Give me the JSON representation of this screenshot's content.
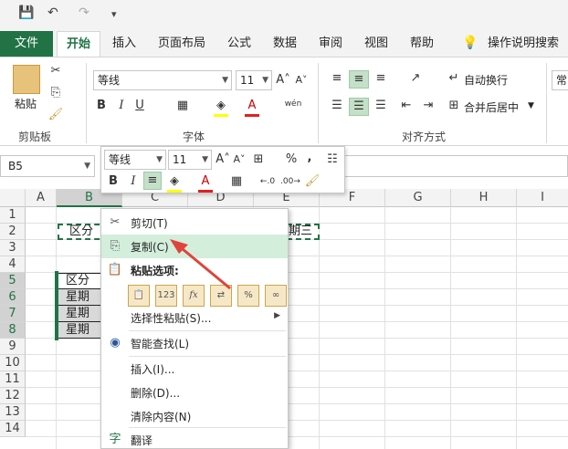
{
  "qat": {
    "save": "💾",
    "undo": "↶",
    "redo": "↷",
    "more": "▾"
  },
  "tabs": [
    "文件",
    "开始",
    "插入",
    "页面布局",
    "公式",
    "数据",
    "审阅",
    "视图",
    "帮助",
    "操作说明搜索"
  ],
  "ribbon": {
    "clipboard": {
      "label": "剪贴板",
      "paste": "粘贴"
    },
    "font": {
      "label": "字体",
      "name": "等线",
      "size": "11"
    },
    "alignment": {
      "label": "对齐方式",
      "wrap": "自动换行",
      "merge": "合并后居中"
    },
    "number": {
      "format": "常"
    }
  },
  "namebox": "B5",
  "columns": [
    "A",
    "B",
    "C",
    "D",
    "E",
    "F",
    "G",
    "H",
    "I"
  ],
  "rows": [
    "1",
    "2",
    "3",
    "4",
    "5",
    "6",
    "7",
    "8",
    "9",
    "10",
    "11",
    "12",
    "13",
    "14"
  ],
  "cells": {
    "b2": "区分",
    "e2": "期三",
    "b5": "区分",
    "b6": "星期",
    "b7": "星期",
    "b8": "星期"
  },
  "mini_toolbar": {
    "font": "等线",
    "size": "11",
    "percent": "%",
    "comma": ","
  },
  "context_menu": {
    "cut": "剪切(T)",
    "copy": "复制(C)",
    "paste_options": "粘贴选项:",
    "paste_special": "选择性粘贴(S)...",
    "smart_lookup": "智能查找(L)",
    "insert": "插入(I)...",
    "delete": "删除(D)...",
    "clear": "清除内容(N)",
    "translate": "翻译"
  },
  "colors": {
    "accent": "#217346",
    "hover": "#d3eedb",
    "arrow": "#e0433a"
  }
}
